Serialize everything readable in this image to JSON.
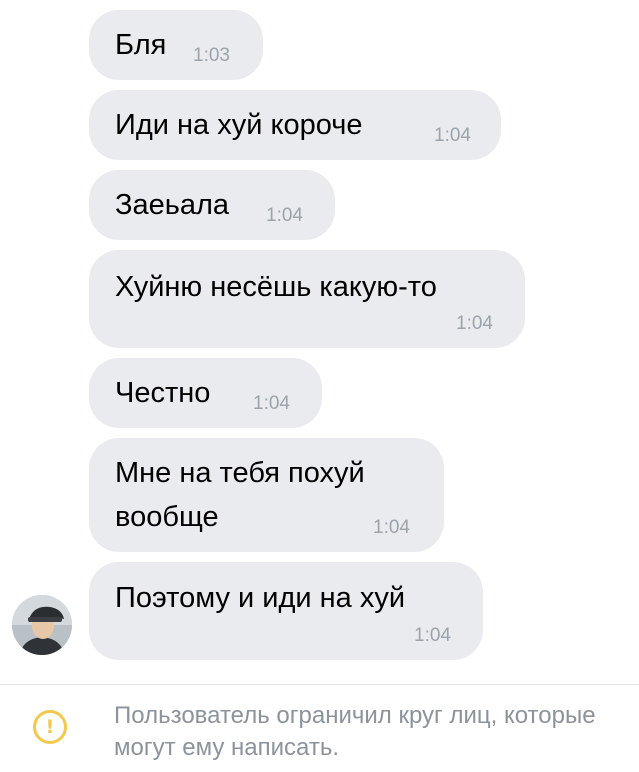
{
  "messages": [
    {
      "text": "Бля",
      "time": "1:03"
    },
    {
      "text": "Иди на хуй короче",
      "time": "1:04"
    },
    {
      "text": "Заеьала",
      "time": "1:04"
    },
    {
      "text": "Хуйню несёшь какую-то",
      "time": "1:04"
    },
    {
      "text": "Честно",
      "time": "1:04"
    },
    {
      "text_line1": "Мне на тебя похуй",
      "text_line2": "вообще",
      "time": "1:04"
    },
    {
      "text": "Поэтому и иди на хуй",
      "time": "1:04"
    }
  ],
  "notice": {
    "icon": "warning-circle-icon",
    "text": "Пользователь ограничил круг лиц, которые могут ему написать."
  },
  "colors": {
    "bubble": "#e9ebef",
    "time": "#9da3ab",
    "notice_text": "#8c939b",
    "warning": "#f2c94c"
  }
}
